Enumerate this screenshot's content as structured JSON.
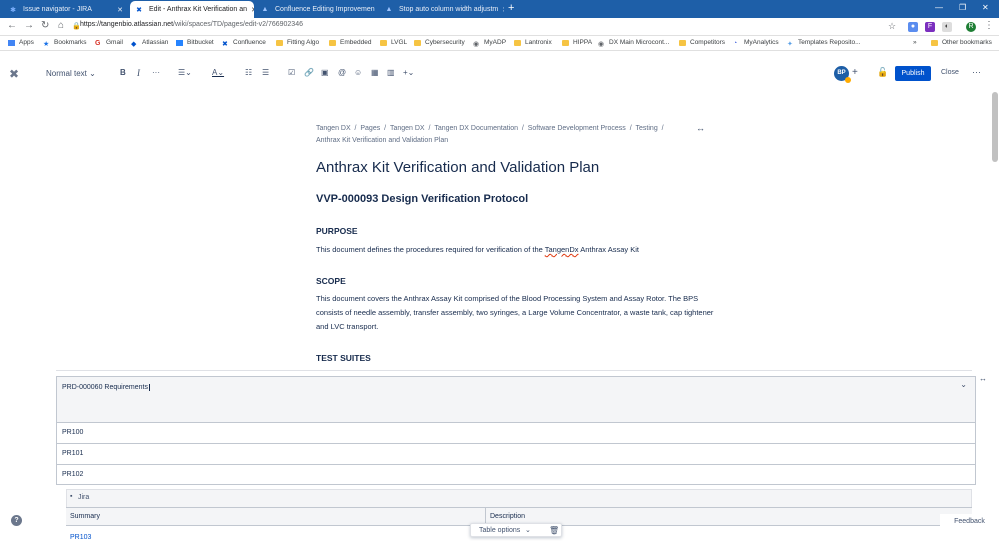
{
  "browser": {
    "tabs": [
      {
        "title": "Issue navigator - JIRA",
        "icon": "jira-icon"
      },
      {
        "title": "Edit - Anthrax Kit Verification an",
        "icon": "confluence-icon",
        "active": true
      },
      {
        "title": "Confluence Editing Improvemen",
        "icon": "atlassian-icon"
      },
      {
        "title": "Stop auto column width adjustm",
        "icon": "atlassian-icon"
      }
    ],
    "url_host": "https://tangenbio.atlassian.net",
    "url_path": "/wiki/spaces/TD/pages/edit-v2/766902346",
    "profile_initial": "R",
    "bookmarks": [
      "Apps",
      "Bookmarks",
      "Gmail",
      "Atlassian",
      "Bitbucket",
      "Confluence",
      "Fitting Algo",
      "Embedded",
      "LVGL",
      "Cybersecurity",
      "MyADP",
      "Lantronix",
      "HIPPA",
      "DX Main Microcont...",
      "Competitors",
      "MyAnalytics",
      "Templates Reposito..."
    ],
    "other_bookmarks": "Other bookmarks",
    "more_bookmarks": "»"
  },
  "editor": {
    "text_style": "Normal text",
    "avatar_initials": "BP",
    "publish_label": "Publish",
    "close_label": "Close"
  },
  "page": {
    "breadcrumb_line1": [
      "Tangen DX",
      "Pages",
      "Tangen DX",
      "Tangen DX Documentation",
      "Software Development Process",
      "Testing"
    ],
    "breadcrumb_line2": "Anthrax Kit Verification and Validation Plan",
    "separator": "/",
    "title": "Anthrax Kit Verification and Validation Plan",
    "subtitle": "VVP-000093 Design Verification Protocol",
    "purpose_heading": "PURPOSE",
    "purpose_text_before": "This document defines the procedures required for verification of the ",
    "purpose_text_spell": "TangenDx",
    "purpose_text_after": " Anthrax Assay Kit",
    "scope_heading": "SCOPE",
    "scope_text": "This document covers the Anthrax Assay Kit comprised of the Blood Processing System and Assay Rotor. The BPS consists of needle assembly, transfer assembly, two syringes, a Large Volume Concentrator, a waste tank, cap tightener and LVC transport.",
    "test_suites_heading": "TEST SUITES"
  },
  "table": {
    "header_cell": "PRD-000060 Requirements",
    "rows": [
      "PR100",
      "PR101",
      "PR102"
    ],
    "jira_label": "Jira",
    "columns": [
      "Summary",
      "Description"
    ],
    "first_link": "PR103",
    "table_options_label": "Table options"
  },
  "help_label": "?",
  "feedback_label": "Feedback"
}
